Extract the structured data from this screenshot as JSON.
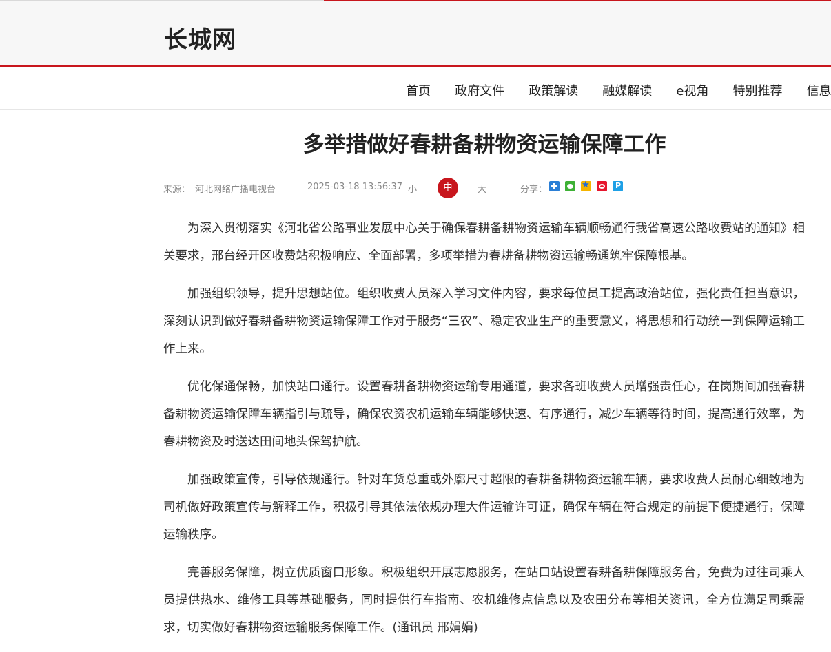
{
  "site": {
    "logo": "长城网"
  },
  "nav": {
    "items": [
      "首页",
      "政府文件",
      "政策解读",
      "融媒解读",
      "e视角",
      "特别推荐",
      "信息反馈"
    ]
  },
  "article": {
    "title": "多举措做好春耕备耕物资运输保障工作",
    "meta": {
      "source_label": "来源：",
      "source": "河北网络广播电视台",
      "datetime": "2025-03-18 13:56:37",
      "font_small": "小",
      "font_medium": "中",
      "font_large": "大",
      "share_label": "分享："
    },
    "paragraphs": [
      "为深入贯彻落实《河北省公路事业发展中心关于确保春耕备耕物资运输车辆顺畅通行我省高速公路收费站的通知》相关要求，邢台经开区收费站积极响应、全面部署，多项举措为春耕备耕物资运输畅通筑牢保障根基。",
      "加强组织领导，提升思想站位。组织收费人员深入学习文件内容，要求每位员工提高政治站位，强化责任担当意识，深刻认识到做好春耕备耕物资运输保障工作对于服务“三农”、稳定农业生产的重要意义，将思想和行动统一到保障运输工作上来。",
      "优化保通保畅，加快站口通行。设置春耕备耕物资运输专用通道，要求各班收费人员增强责任心，在岗期间加强春耕备耕物资运输保障车辆指引与疏导，确保农资农机运输车辆能够快速、有序通行，减少车辆等待时间，提高通行效率，为春耕物资及时送达田间地头保驾护航。",
      "加强政策宣传，引导依规通行。针对车货总重或外廓尺寸超限的春耕备耕物资运输车辆，要求收费人员耐心细致地为司机做好政策宣传与解释工作，积极引导其依法依规办理大件运输许可证，确保车辆在符合规定的前提下便捷通行，保障运输秩序。",
      "完善服务保障，树立优质窗口形象。积极组织开展志愿服务，在站口站设置春耕备耕保障服务台，免费为过往司乘人员提供热水、维修工具等基础服务，同时提供行车指南、农机维修点信息以及农田分布等相关资讯，全方位满足司乘需求，切实做好春耕物资运输服务保障工作。(通讯员 邢娟娟)"
    ]
  },
  "share": {
    "icons": [
      "add-share-icon",
      "wechat-icon",
      "qzone-icon",
      "weibo-icon",
      "pengyou-icon"
    ]
  },
  "colors": {
    "brand_red": "#c8161d",
    "header_bg": "#f7f7f7",
    "text": "#333333",
    "meta_text": "#888888"
  }
}
